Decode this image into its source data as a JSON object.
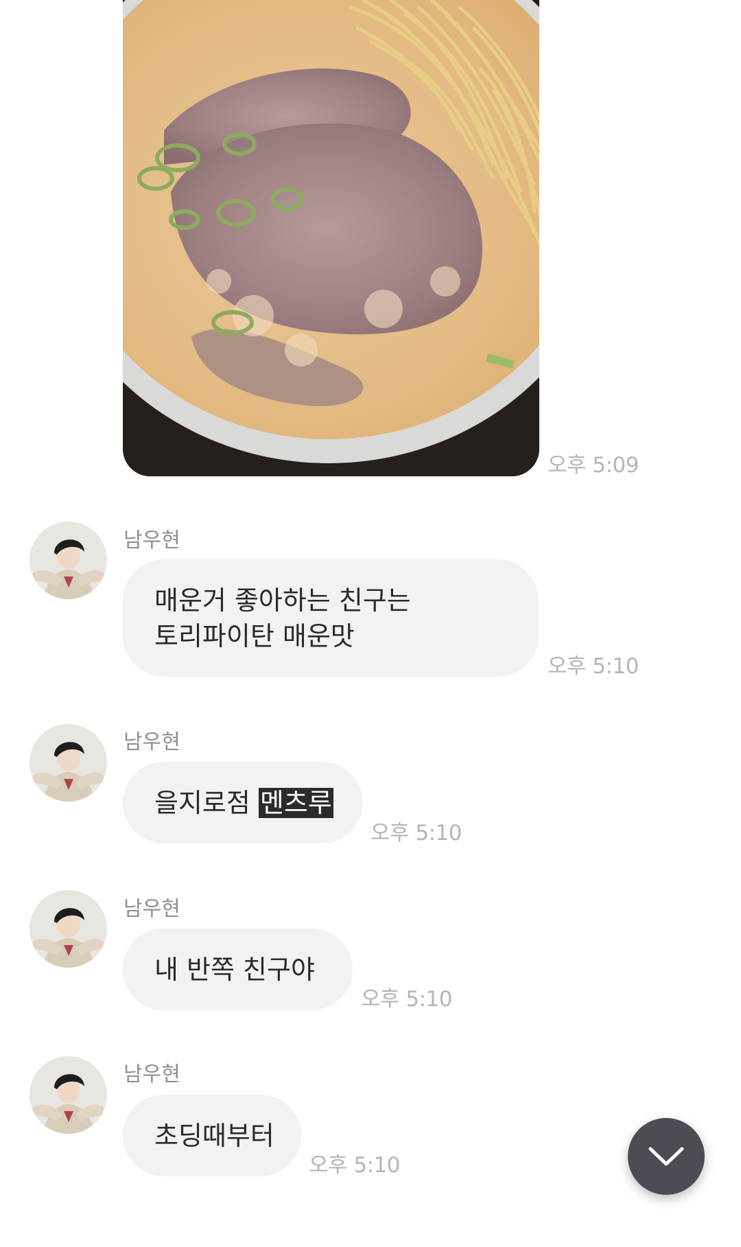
{
  "photo_message": {
    "image_alt": "ramen bowl with sliced pork, green onions and noodles in creamy broth",
    "time": "오후 5:09"
  },
  "messages": [
    {
      "sender": "남우현",
      "lines": [
        "매운거 좋아하는 친구는",
        "토리파이탄 매운맛"
      ],
      "time": "오후 5:10"
    },
    {
      "sender": "남우현",
      "text_plain": "을지로점 ",
      "text_highlight": "멘츠루",
      "time": "오후 5:10"
    },
    {
      "sender": "남우현",
      "text": "내 반쪽 친구야",
      "time": "오후 5:10"
    },
    {
      "sender": "남우현",
      "text": "초딩때부터",
      "time": "오후 5:10"
    }
  ],
  "scroll_button": {
    "icon": "chevron-down-icon"
  },
  "colors": {
    "bubble_bg": "#f2f2f4",
    "time_text": "#b5b5b5",
    "sender_text": "#8e8e8e",
    "highlight_bg": "#2b2b2b",
    "fab_bg": "#4a4d54"
  }
}
